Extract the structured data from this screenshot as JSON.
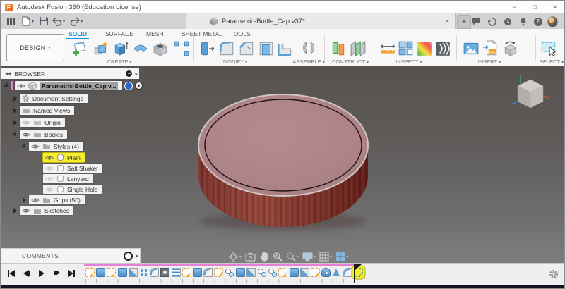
{
  "titlebar": {
    "logo_letter": "F",
    "title": "Autodesk Fusion 360 (Education License)",
    "minimize": "−",
    "maximize": "□",
    "close": "×"
  },
  "toolbar": {
    "document_tab": {
      "title": "Parametric-Bottle_Cap v37*",
      "close": "×"
    },
    "new_tab": "+",
    "help": "?"
  },
  "ribbon": {
    "design_button": "DESIGN",
    "tabs": [
      {
        "label": "SOLID",
        "active": true
      },
      {
        "label": "SURFACE",
        "active": false
      },
      {
        "label": "MESH",
        "active": false
      },
      {
        "label": "SHEET METAL",
        "active": false
      },
      {
        "label": "TOOLS",
        "active": false
      }
    ],
    "groups": [
      {
        "label": "CREATE"
      },
      {
        "label": "MODIFY"
      },
      {
        "label": "ASSEMBLE"
      },
      {
        "label": "CONSTRUCT"
      },
      {
        "label": "INSPECT"
      },
      {
        "label": "INSERT"
      },
      {
        "label": "SELECT"
      }
    ],
    "insert_svg_badge": "SVG"
  },
  "browser": {
    "header": "BROWSER",
    "items": [
      {
        "label": "Parametric-Bottle_Cap v...",
        "level": 0,
        "expanded": true,
        "selected": true
      },
      {
        "label": "Document Settings",
        "level": 1
      },
      {
        "label": "Named Views",
        "level": 1
      },
      {
        "label": "Origin",
        "level": 1,
        "hidden": true
      },
      {
        "label": "Bodies",
        "level": 1,
        "expanded": true
      },
      {
        "label": "Styles (4)",
        "level": 2,
        "expanded": true
      },
      {
        "label": "Plain",
        "level": 3,
        "highlighted": true,
        "visible": true
      },
      {
        "label": "Salt Shaker",
        "level": 3,
        "hidden": true
      },
      {
        "label": "Lanyard",
        "level": 3,
        "hidden": true
      },
      {
        "label": "Single Hole",
        "level": 3,
        "hidden": true
      },
      {
        "label": "Grips (50)",
        "level": 2
      },
      {
        "label": "Sketches",
        "level": 1
      }
    ]
  },
  "comments": {
    "label": "COMMENTS"
  },
  "navbar_icons": [
    "orbit",
    "look-at",
    "pan",
    "zoom",
    "fit",
    "display-settings",
    "grid-settings",
    "viewports"
  ],
  "timeline": {
    "features": [
      "sketch",
      "extrude",
      "sketch",
      "extrude",
      "chamfer",
      "pattern",
      "fillet",
      "shell",
      "coil",
      "sketch",
      "extrude",
      "fillet",
      "sketch",
      "hole",
      "extrude",
      "chamfer",
      "hole",
      "hole",
      "sketch",
      "extrude",
      "chamfer",
      "sketch",
      "revolve",
      "mirror",
      "fillet",
      "sketch"
    ],
    "highlighted_index": 25
  },
  "viewport": {
    "model": "red bottle cap",
    "cap_top_color": "#ad8286",
    "cap_side_color": "#8a3a31"
  },
  "ui": {
    "caret": "▾",
    "collapse": "◀◀",
    "chevron": "▸"
  },
  "colors": {
    "accent_blue": "#0696d7",
    "highlight_yellow": "#f5ee2e",
    "accent_pink": "#e87fd6"
  }
}
